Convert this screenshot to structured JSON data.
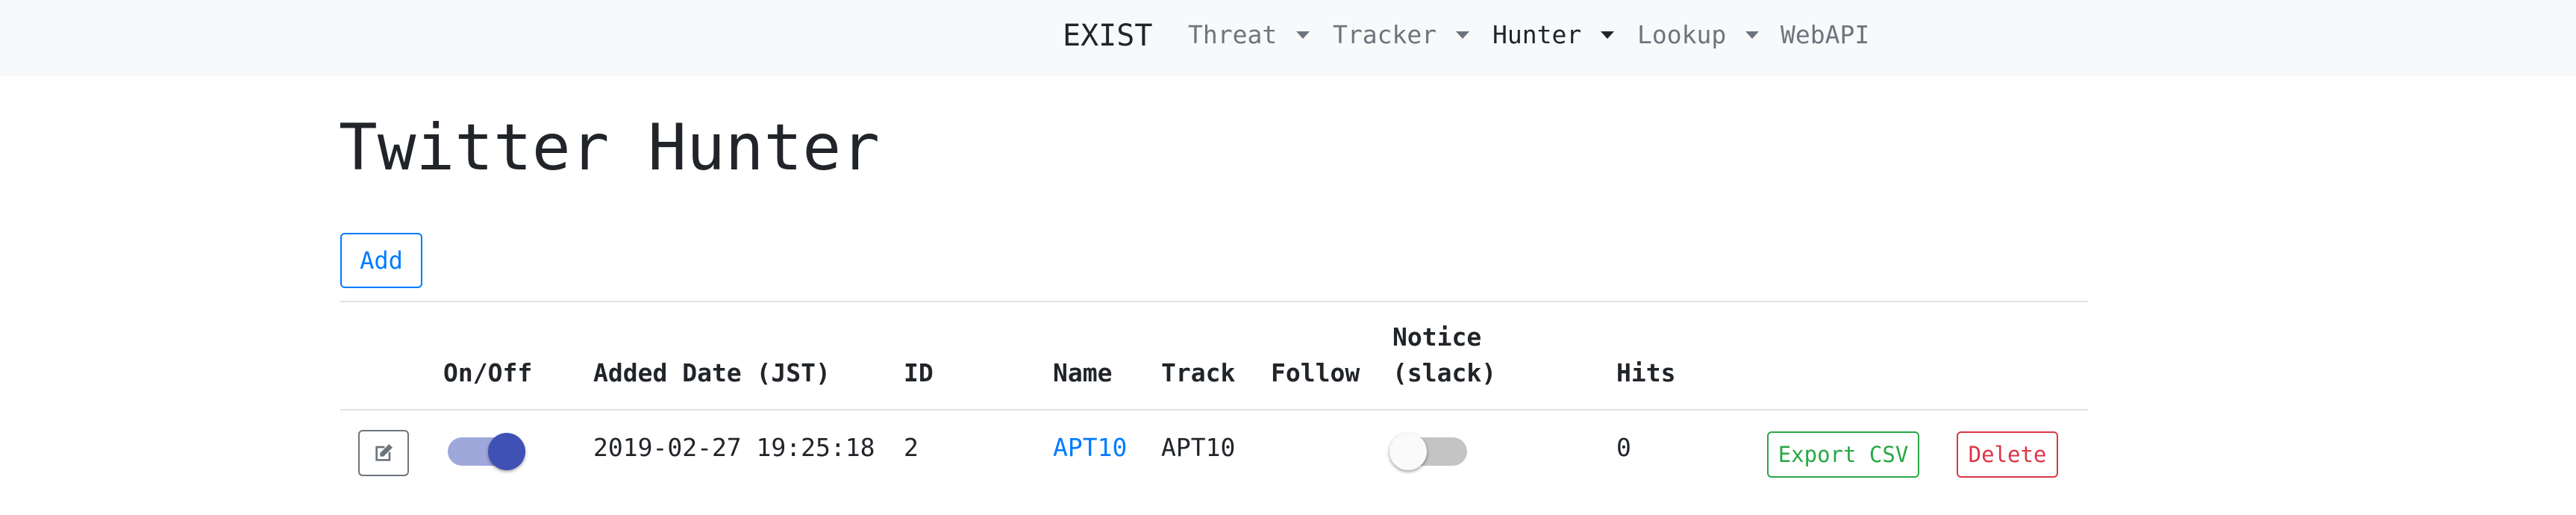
{
  "navbar": {
    "brand": "EXIST",
    "items": [
      {
        "label": "Threat",
        "dropdown": true
      },
      {
        "label": "Tracker",
        "dropdown": true
      },
      {
        "label": "Hunter",
        "dropdown": true,
        "active": true
      },
      {
        "label": "Lookup",
        "dropdown": true
      },
      {
        "label": "WebAPI",
        "dropdown": false
      }
    ]
  },
  "page": {
    "title": "Twitter Hunter",
    "add_label": "Add"
  },
  "table": {
    "headers": {
      "onoff": "On/Off",
      "added_date": "Added Date (JST)",
      "id": "ID",
      "name": "Name",
      "track": "Track",
      "follow": "Follow",
      "notice_line1": "Notice",
      "notice_line2": "(slack)",
      "hits": "Hits"
    },
    "rows": [
      {
        "enabled": true,
        "added_date": "2019-02-27 19:25:18",
        "id": "2",
        "name": "APT10",
        "track": "APT10",
        "follow": "",
        "notice_slack": false,
        "hits": "0",
        "export_label": "Export CSV",
        "delete_label": "Delete"
      }
    ]
  },
  "icons": {
    "edit": "edit-icon",
    "caret": "caret-down-icon"
  },
  "colors": {
    "primary": "#007bff",
    "success": "#28a745",
    "danger": "#dc3545",
    "toggle_on": "#3f51b5",
    "navbar_bg": "#f8f9fa"
  }
}
